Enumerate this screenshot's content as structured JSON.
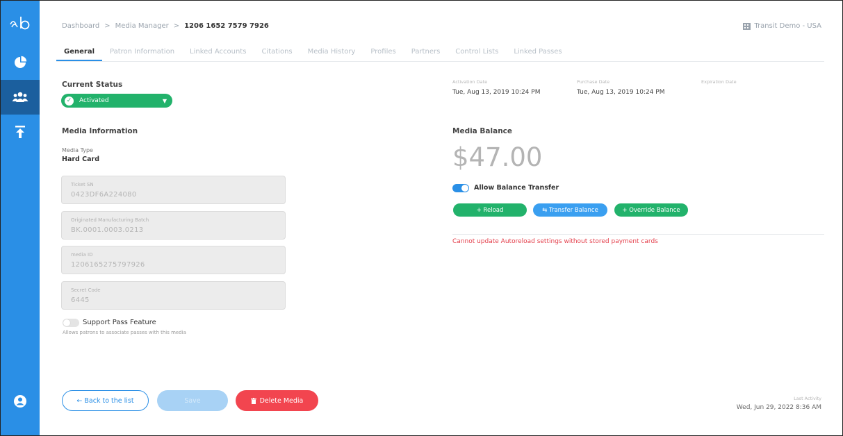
{
  "breadcrumb": {
    "dashboard": "Dashboard",
    "media_manager": "Media Manager",
    "current": "1206 1652 7579 7926",
    "separator": ">"
  },
  "org": {
    "name": "Transit Demo - USA",
    "icon": "building-icon"
  },
  "tabs": [
    {
      "label": "General",
      "active": true
    },
    {
      "label": "Patron Information"
    },
    {
      "label": "Linked Accounts"
    },
    {
      "label": "Citations"
    },
    {
      "label": "Media History"
    },
    {
      "label": "Profiles"
    },
    {
      "label": "Partners"
    },
    {
      "label": "Control Lists"
    },
    {
      "label": "Linked Passes"
    }
  ],
  "status": {
    "heading": "Current Status",
    "value": "Activated",
    "color": "#22b26b"
  },
  "media_info": {
    "heading": "Media Information",
    "type_label": "Media Type",
    "type_value": "Hard Card",
    "fields": [
      {
        "label": "Ticket SN",
        "value": "0423DF6A224080"
      },
      {
        "label": "Originated Manufacturing Batch",
        "value": "BK.0001.0003.0213"
      },
      {
        "label": "media ID",
        "value": "1206165275797926"
      },
      {
        "label": "Secret Code",
        "value": "6445"
      }
    ]
  },
  "support_pass": {
    "label": "Support Pass Feature",
    "description": "Allows patrons to associate passes with this media",
    "enabled": false
  },
  "dates": [
    {
      "label": "Activation Date",
      "value": "Tue, Aug 13, 2019 10:24 PM"
    },
    {
      "label": "Purchase Date",
      "value": "Tue, Aug 13, 2019 10:24 PM"
    },
    {
      "label": "Expiration Date",
      "value": ""
    }
  ],
  "balance": {
    "heading": "Media Balance",
    "amount": "$47.00",
    "allow_transfer_label": "Allow Balance Transfer",
    "allow_transfer": true
  },
  "balance_actions": [
    {
      "label": "+ Reload",
      "color": "#22b26b"
    },
    {
      "label": "⇆ Transfer Balance",
      "color": "#3a9ff0"
    },
    {
      "label": "+ Override Balance",
      "color": "#22b26b"
    }
  ],
  "error_message": "Cannot update Autoreload settings without stored payment cards",
  "footer": {
    "back_label": "← Back to the list",
    "save_label": "Save",
    "delete_label": "Delete Media",
    "last_activity_label": "Last Activity",
    "last_activity_value": "Wed, Jun 29, 2022 8:36 AM"
  },
  "colors": {
    "accent": "#2a8fe6",
    "sidebar_active": "#1b5f9e",
    "success": "#22b26b",
    "danger": "#f2454f",
    "error_text": "#e4404c"
  }
}
